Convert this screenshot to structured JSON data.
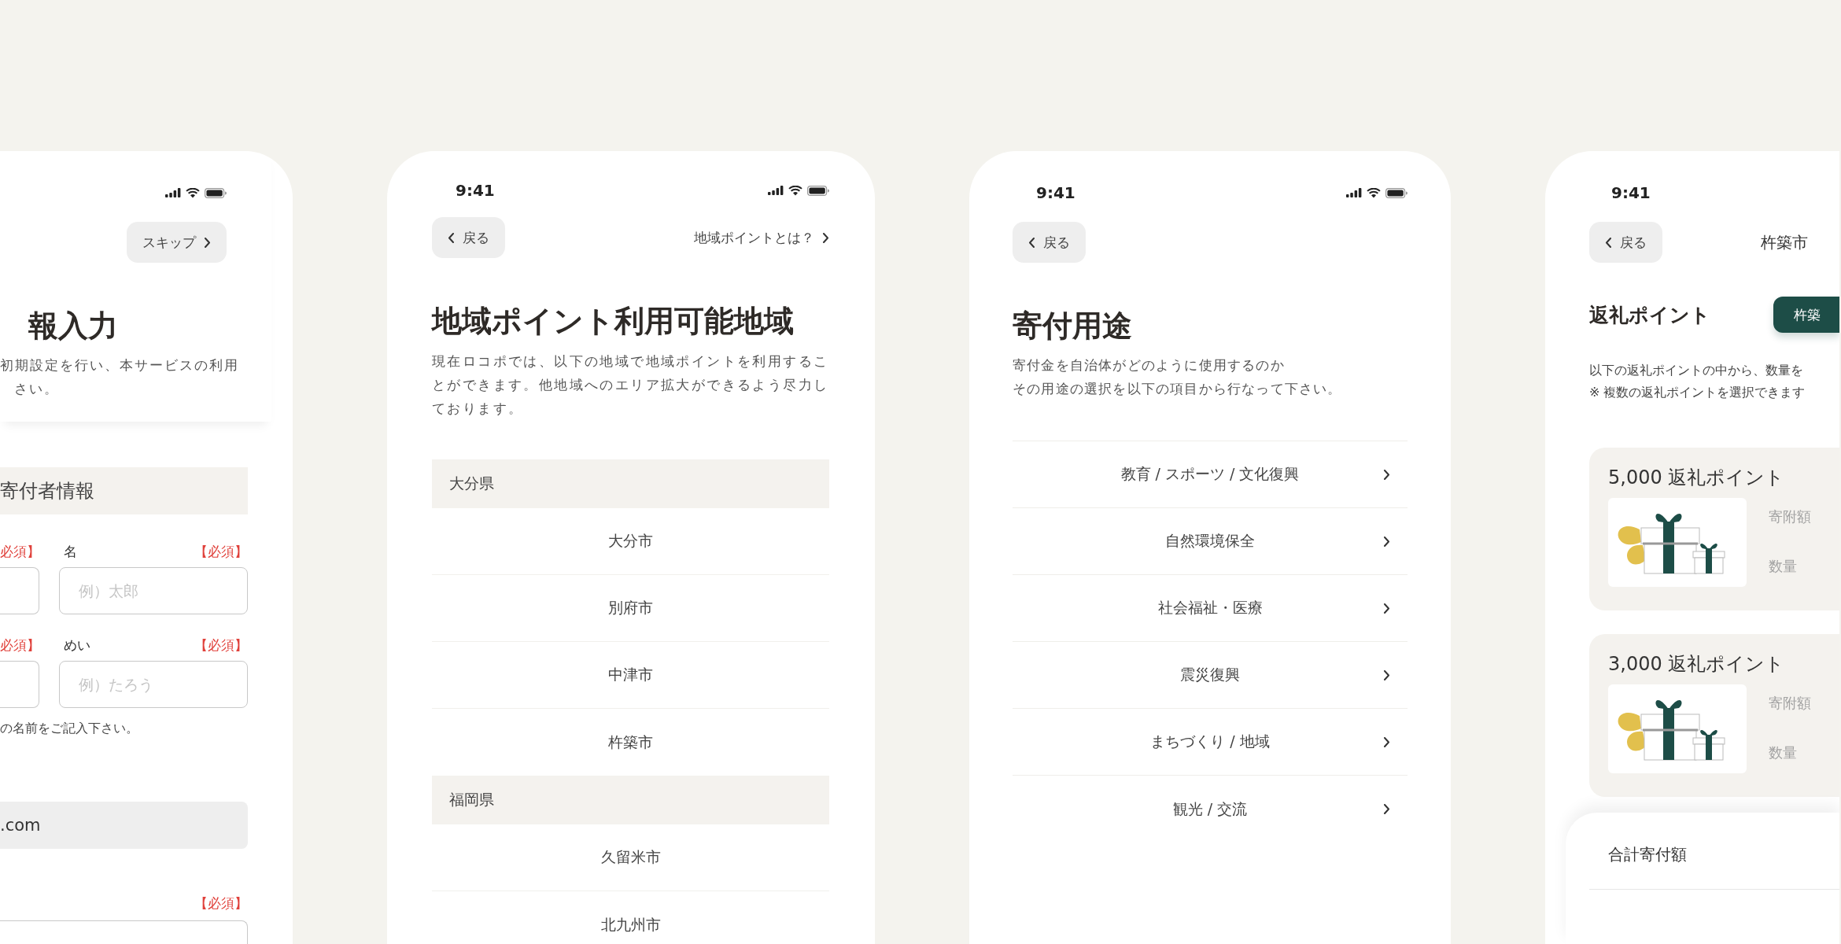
{
  "phones": [
    {
      "kind": "donor_form",
      "skip_button": "スキップ",
      "title": "報入力",
      "description_lines": [
        "初期設定を行い、本サービスの利用",
        "さい。"
      ],
      "section": "寄付者情報",
      "name_rows": [
        {
          "left_required": "必須】",
          "label": "名",
          "required": "【必須】",
          "placeholder": "例）太郎"
        },
        {
          "left_required": "必須】",
          "label": "めい",
          "required": "【必須】",
          "placeholder": "例）たろう"
        }
      ],
      "note": "の名前をご記入下さい。",
      "email_value": ".com",
      "last_required": "【必須】"
    },
    {
      "kind": "region_list",
      "time": "9:41",
      "back_button": "戻る",
      "help_link": "地域ポイントとは？",
      "title": "地域ポイント利用可能地域",
      "description": "現在ロコポでは、以下の地域で地域ポイントを利用することができます。他地域へのエリア拡大ができるよう尽力しております。",
      "prefectures": [
        {
          "name": "大分県",
          "cities": [
            "大分市",
            "別府市",
            "中津市",
            "杵築市"
          ]
        },
        {
          "name": "福岡県",
          "cities": [
            "久留米市",
            "北九州市"
          ]
        }
      ]
    },
    {
      "kind": "purpose_list",
      "time": "9:41",
      "back_button": "戻る",
      "title": "寄付用途",
      "description_lines": [
        "寄付金を自治体がどのように使用するのか",
        "その用途の選択を以下の項目から行なって下さい。"
      ],
      "purposes": [
        "教育 / スポーツ / 文化復興",
        "自然環境保全",
        "社会福祉・医療",
        "震災復興",
        "まちづくり / 地域",
        "観光 / 交流"
      ]
    },
    {
      "kind": "points",
      "time": "9:41",
      "back_button": "戻る",
      "city": "杵築市",
      "title": "返礼ポイント",
      "city_button": "杵築",
      "description_lines": [
        "以下の返礼ポイントの中から、数量を",
        "※ 複数の返礼ポイントを選択できます"
      ],
      "offers": [
        {
          "title": "5,000 返礼ポイント",
          "amount_label": "寄附額",
          "quantity_label": "数量"
        },
        {
          "title": "3,000 返礼ポイント",
          "amount_label": "寄附額",
          "quantity_label": "数量"
        }
      ],
      "total_label": "合計寄付額"
    }
  ]
}
